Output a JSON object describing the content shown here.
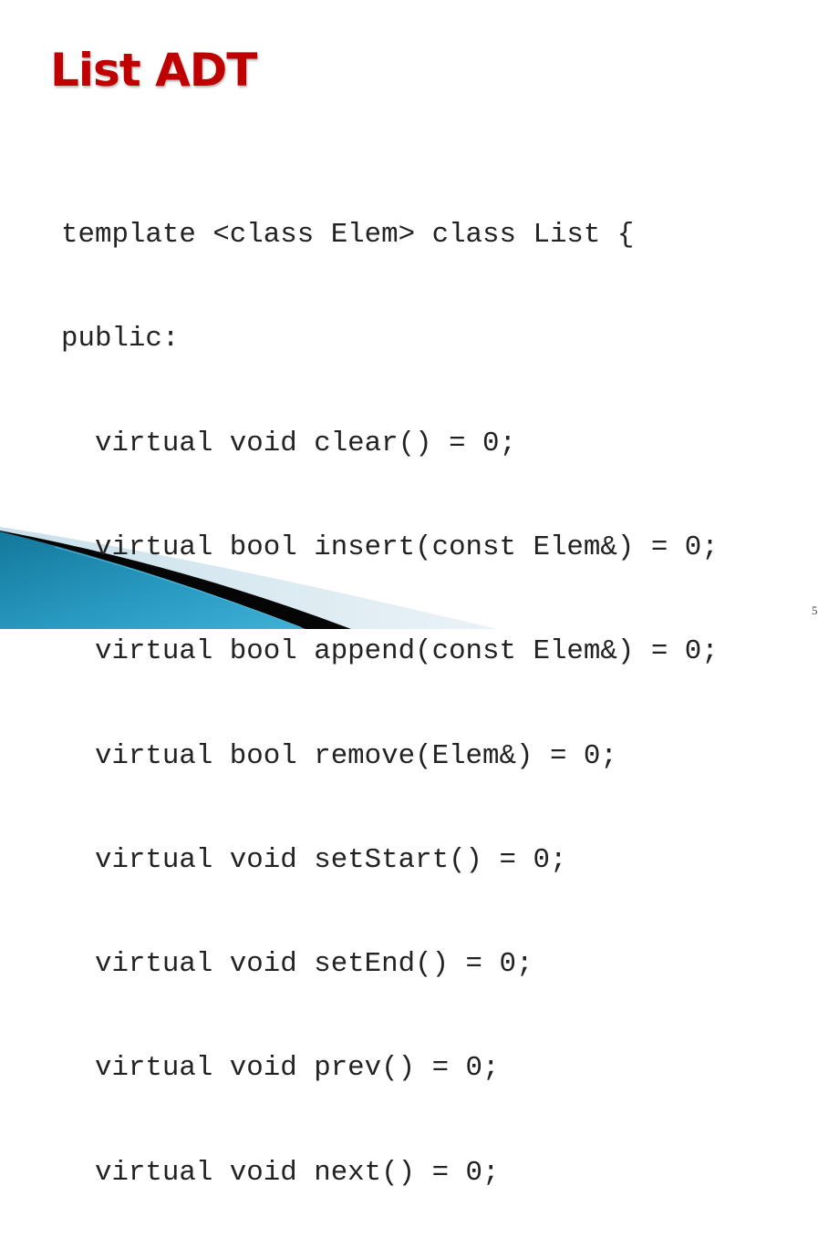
{
  "slide": {
    "title": "List ADT",
    "code_lines": [
      "template <class Elem> class List {",
      "public:",
      "  virtual void clear() = 0;",
      "  virtual bool insert(const Elem&) = 0;",
      "  virtual bool append(const Elem&) = 0;",
      "  virtual bool remove(Elem&) = 0;",
      "  virtual void setStart() = 0;",
      "  virtual void setEnd() = 0;",
      "  virtual void prev() = 0;",
      "  virtual void next() = 0;"
    ],
    "page_number": "5"
  },
  "colors": {
    "title": "#C00000",
    "swoosh_blue": "#1F8FB4",
    "swoosh_dark": "#000000",
    "swoosh_light": "#D6E8F0"
  }
}
